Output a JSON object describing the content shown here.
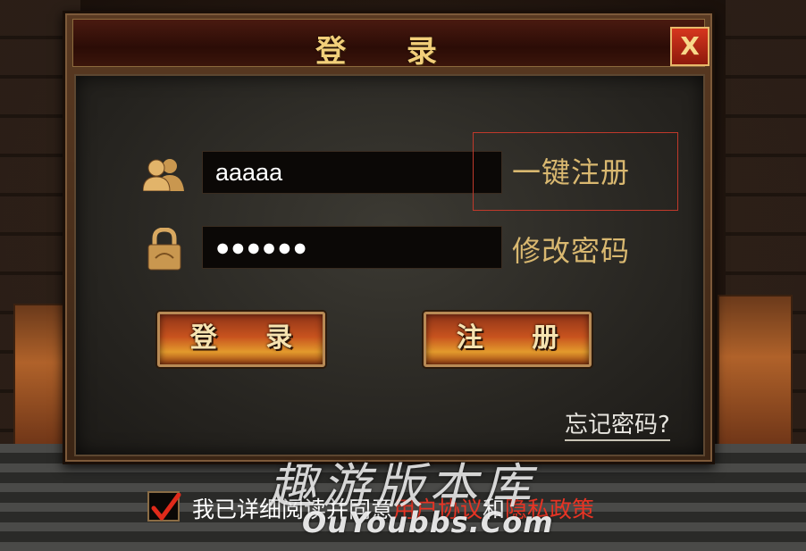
{
  "dialog": {
    "title": "登 录",
    "close_label": "X"
  },
  "form": {
    "username_value": "aaaaa",
    "password_value": "●●●●●●",
    "quick_register_label": "一键注册",
    "change_password_label": "修改密码",
    "login_button": "登 录",
    "register_button": "注 册",
    "forgot_password_label": "忘记密码?"
  },
  "agreement": {
    "checked": true,
    "text_prefix": "我已详细阅读并同意",
    "user_agreement": "用户协议",
    "and": "和",
    "privacy_policy": "隐私政策"
  },
  "watermark": {
    "cn": "趣游版本库",
    "en": "OuYoubbs.Com"
  },
  "icons": {
    "user": "users-icon",
    "lock": "lock-icon",
    "check": "check-icon",
    "close": "close-icon"
  },
  "colors": {
    "gold_text": "#d9b870",
    "title_gold": "#f2cf7a",
    "link_red": "#e83424",
    "close_red": "#c62a16"
  }
}
